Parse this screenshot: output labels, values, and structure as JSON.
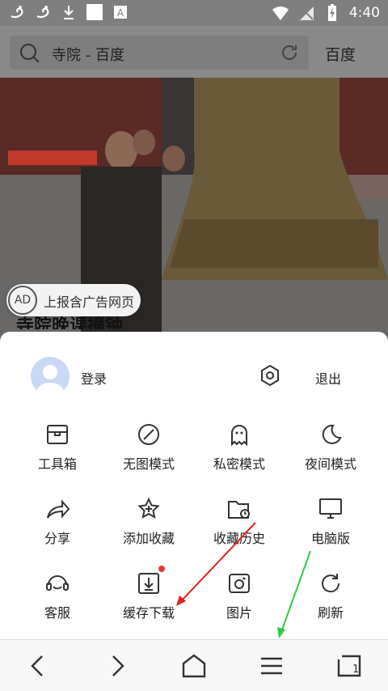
{
  "status_bar": {
    "time": "4:40",
    "icons": [
      "uc-browser-icon",
      "uc-browser-icon",
      "download-icon",
      "square-icon",
      "a-icon",
      "wifi-icon",
      "signal-off-icon",
      "battery-charging-icon"
    ]
  },
  "address_bar": {
    "page_title": "寺院 - 百度",
    "right_button": "百度"
  },
  "content": {
    "ad_label": "上报含广告网页",
    "ad_icon_text": "AD",
    "headline": "寺院晚课撞钟"
  },
  "menu": {
    "login": "登录",
    "logout": "退出",
    "items": [
      {
        "label": "工具箱",
        "icon": "toolbox-icon"
      },
      {
        "label": "无图模式",
        "icon": "no-image-icon"
      },
      {
        "label": "私密模式",
        "icon": "ghost-icon"
      },
      {
        "label": "夜间模式",
        "icon": "moon-icon"
      },
      {
        "label": "分享",
        "icon": "share-icon"
      },
      {
        "label": "添加收藏",
        "icon": "star-plus-icon"
      },
      {
        "label": "收藏历史",
        "icon": "folder-history-icon"
      },
      {
        "label": "电脑版",
        "icon": "monitor-icon"
      },
      {
        "label": "客服",
        "icon": "headset-icon"
      },
      {
        "label": "缓存下载",
        "icon": "download-box-icon",
        "badge": true
      },
      {
        "label": "图片",
        "icon": "camera-icon"
      },
      {
        "label": "刷新",
        "icon": "refresh-icon"
      }
    ]
  },
  "bottom_nav": {
    "tab_count": "1"
  },
  "colors": {
    "status_bar": "#7f7f7f",
    "address_bar": "#8a8a8a",
    "badge": "#e53935",
    "arrow_red": "#e02020",
    "arrow_green": "#2ecc40"
  }
}
